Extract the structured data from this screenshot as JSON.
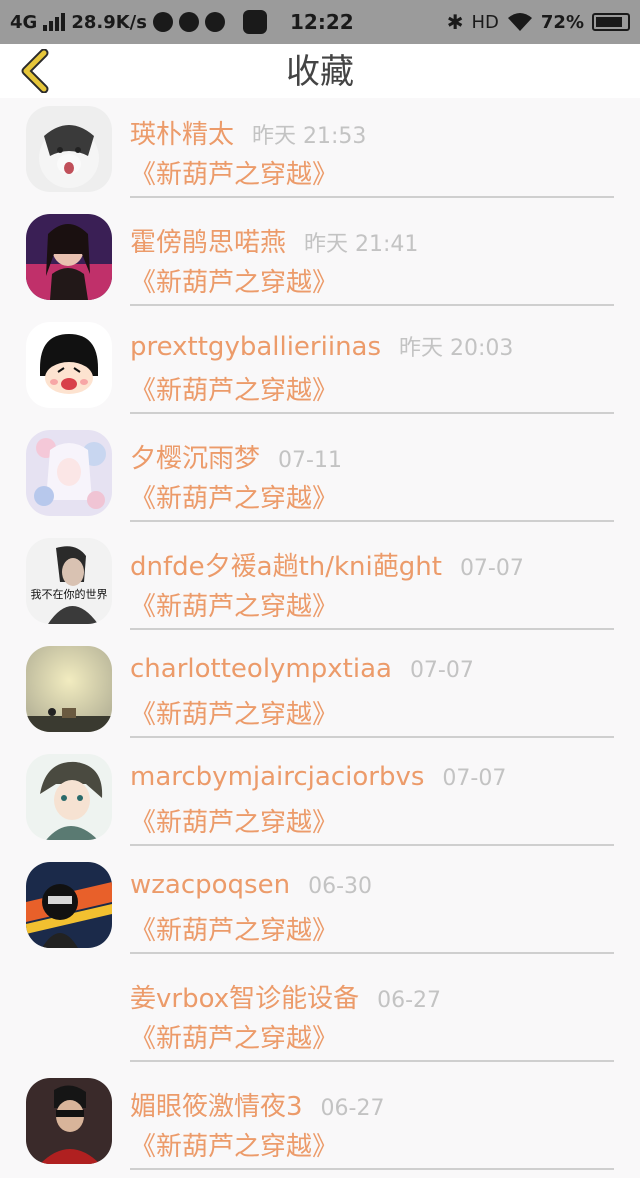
{
  "status_bar": {
    "network": "4G",
    "speed": "28.9K/s",
    "time": "12:22",
    "hd": "HD",
    "battery": "72%"
  },
  "header": {
    "title": "收藏",
    "back_icon": "chevron-left-icon",
    "back_color": "#e6c63a"
  },
  "favorites": [
    {
      "name": "瑛朴精太",
      "time": "昨天 21:53",
      "work": "《新葫芦之穿越》"
    },
    {
      "name": "霍傍鹃思喏燕",
      "time": "昨天 21:41",
      "work": "《新葫芦之穿越》"
    },
    {
      "name": "prexttgyballieriinas",
      "time": "昨天 20:03",
      "work": "《新葫芦之穿越》"
    },
    {
      "name": "夕樱沉雨梦",
      "time": "07-11",
      "work": "《新葫芦之穿越》"
    },
    {
      "name": "dnfde夕褑a趟th/kni葩ght",
      "time": "07-07",
      "work": "《新葫芦之穿越》"
    },
    {
      "name": "charlotteolympxtiaa",
      "time": "07-07",
      "work": "《新葫芦之穿越》"
    },
    {
      "name": "marcbymjaircjaciorbvs",
      "time": "07-07",
      "work": "《新葫芦之穿越》"
    },
    {
      "name": "wzacpoqsen",
      "time": "06-30",
      "work": "《新葫芦之穿越》"
    },
    {
      "name": "姜vrbox智诊能设备",
      "time": "06-27",
      "work": "《新葫芦之穿越》"
    },
    {
      "name": "媚眼筱激情夜3",
      "time": "06-27",
      "work": "《新葫芦之穿越》"
    }
  ],
  "avatar_captions": {
    "item5": "我不在你的世界"
  },
  "colors": {
    "accent": "#ec9b6a",
    "timestamp": "#c3c3c3",
    "title": "#444444",
    "background": "#f9f8f9"
  }
}
